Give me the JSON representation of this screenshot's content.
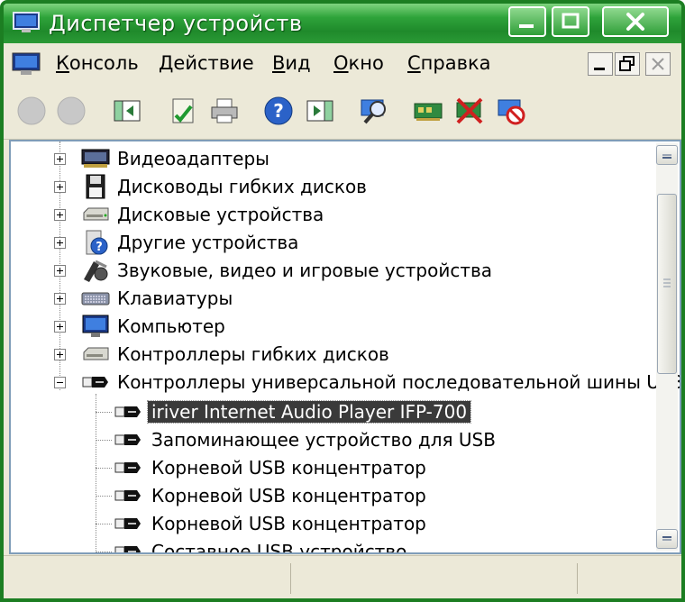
{
  "window": {
    "title": "Диспетчер устройств",
    "colors": {
      "titlebar": "#2ea33a",
      "frame": "#1c7e22",
      "face": "#ece9d8",
      "selection": "#3a3a3a"
    }
  },
  "menu": {
    "items": [
      {
        "first": "К",
        "rest": "онсоль"
      },
      {
        "first": "Д",
        "rest": "ействие"
      },
      {
        "first": "В",
        "rest": "ид"
      },
      {
        "first": "О",
        "rest": "кно"
      },
      {
        "first": "С",
        "rest": "правка"
      }
    ]
  },
  "toolbar": {
    "icons": [
      "back-icon",
      "forward-icon",
      "show-hide-tree-icon",
      "properties-icon",
      "print-icon",
      "help-icon",
      "show-hide-action-pane-icon",
      "scan-hardware-icon",
      "update-driver-icon",
      "disable-device-icon",
      "uninstall-device-icon"
    ]
  },
  "tree": {
    "items": [
      {
        "label": "Видеоадаптеры",
        "icon": "display-adapter-icon",
        "level": 0,
        "expanded": false
      },
      {
        "label": "Дисководы гибких дисков",
        "icon": "floppy-drive-icon",
        "level": 0,
        "expanded": false
      },
      {
        "label": "Дисковые устройства",
        "icon": "disk-drive-icon",
        "level": 0,
        "expanded": false
      },
      {
        "label": "Другие устройства",
        "icon": "other-devices-icon",
        "level": 0,
        "expanded": false
      },
      {
        "label": "Звуковые, видео и игровые устройства",
        "icon": "sound-video-icon",
        "level": 0,
        "expanded": false
      },
      {
        "label": "Клавиатуры",
        "icon": "keyboard-icon",
        "level": 0,
        "expanded": false
      },
      {
        "label": "Компьютер",
        "icon": "computer-icon",
        "level": 0,
        "expanded": false
      },
      {
        "label": "Контроллеры гибких дисков",
        "icon": "floppy-controller-icon",
        "level": 0,
        "expanded": false
      },
      {
        "label": "Контроллеры универсальной последовательной шины USB",
        "icon": "usb-controller-icon",
        "level": 0,
        "expanded": true
      },
      {
        "label": "iriver Internet Audio Player IFP-700",
        "icon": "usb-device-icon",
        "level": 1,
        "selected": true
      },
      {
        "label": "Запоминающее устройство для USB",
        "icon": "usb-device-icon",
        "level": 1
      },
      {
        "label": "Корневой USB концентратор",
        "icon": "usb-device-icon",
        "level": 1
      },
      {
        "label": "Корневой USB концентратор",
        "icon": "usb-device-icon",
        "level": 1
      },
      {
        "label": "Корневой USB концентратор",
        "icon": "usb-device-icon",
        "level": 1
      },
      {
        "label": "Составное USB устройство",
        "icon": "usb-device-icon",
        "level": 1
      }
    ]
  }
}
